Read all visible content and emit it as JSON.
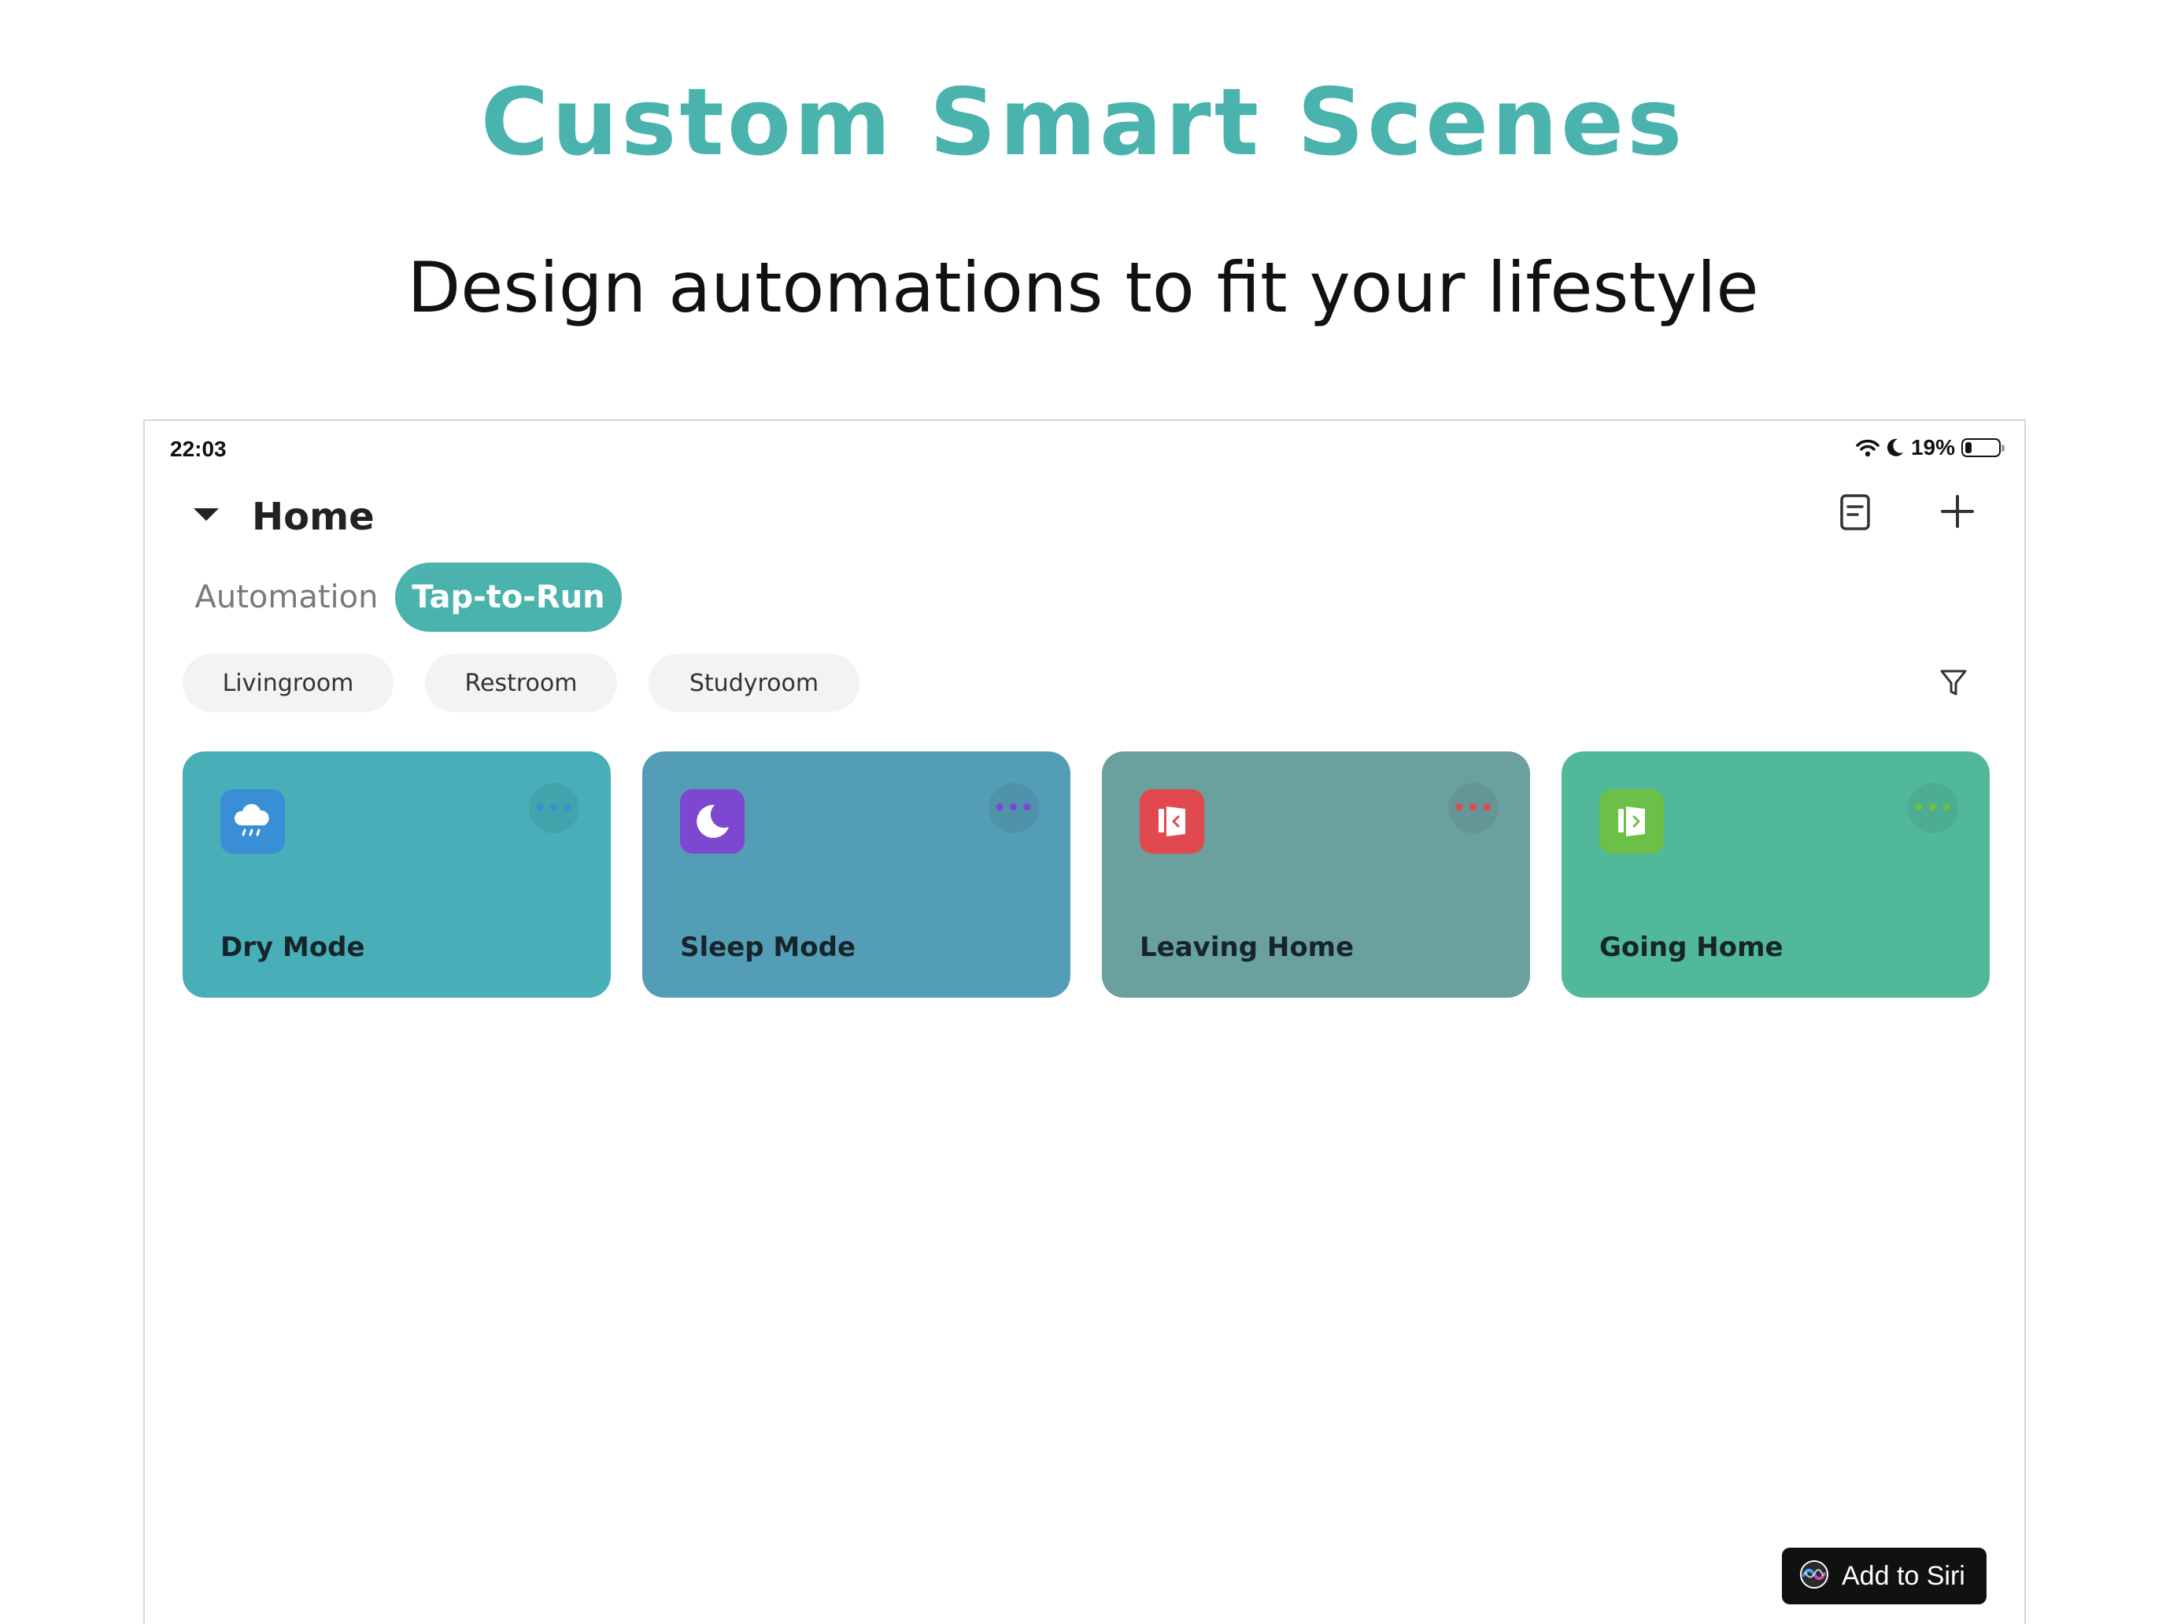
{
  "hero": {
    "title": "Custom Smart Scenes",
    "subtitle": "Design automations to fit your lifestyle",
    "title_color": "#4bb3ad"
  },
  "status_bar": {
    "time": "22:03",
    "battery_percent": "19%",
    "battery_level": 0.19,
    "icons": [
      "wifi-icon",
      "moon-icon",
      "battery-icon"
    ]
  },
  "header": {
    "title": "Home",
    "icons": [
      "caret-down-icon",
      "document-icon",
      "plus-icon"
    ]
  },
  "tabs": [
    {
      "label": "Automation",
      "active": false
    },
    {
      "label": "Tap-to-Run",
      "active": true
    }
  ],
  "room_filters": [
    {
      "label": "Livingroom"
    },
    {
      "label": "Restroom"
    },
    {
      "label": "Studyroom"
    }
  ],
  "scenes": [
    {
      "label": "Dry Mode",
      "icon": "cloud-rain-icon",
      "card_color": "#48aeb8",
      "icon_color": "#3a8ed6",
      "dots_color": "#3a8ed6"
    },
    {
      "label": "Sleep Mode",
      "icon": "moon-icon",
      "card_color": "#549db6",
      "icon_color": "#7d47cf",
      "dots_color": "#7d47cf"
    },
    {
      "label": "Leaving Home",
      "icon": "door-exit-icon",
      "card_color": "#6aa09e",
      "icon_color": "#e04a4f",
      "dots_color": "#e04a4f"
    },
    {
      "label": "Going Home",
      "icon": "door-enter-icon",
      "card_color": "#51b89a",
      "icon_color": "#6cbf47",
      "dots_color": "#6cbf47"
    }
  ],
  "siri": {
    "label": "Add to Siri",
    "icon": "siri-icon"
  }
}
